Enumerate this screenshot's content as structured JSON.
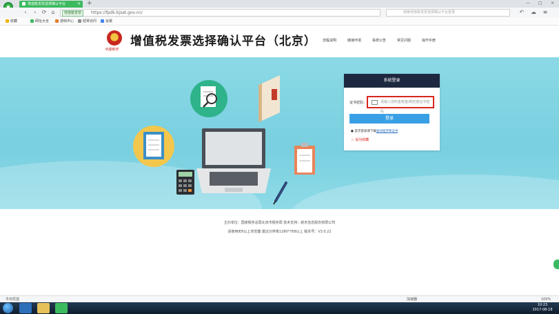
{
  "browser": {
    "tab_title": "增值税发票选择确认平台",
    "tab_close": "×",
    "new_tab": "+",
    "address_badge": "增值税发票",
    "address_url": "https://fpdk.bjsat.gov.cn/",
    "search_placeholder": "搜索增值税发票选择确认平台登录",
    "back": "‹",
    "forward": "›",
    "reload": "⟳",
    "home": "⌂"
  },
  "bookmarks": [
    {
      "label": "收藏",
      "color": "#f0b400"
    },
    {
      "label": "网址大全",
      "color": "#3cba5f"
    },
    {
      "label": "游戏中心",
      "color": "#e57d2a"
    },
    {
      "label": "经常访问",
      "color": "#8e8e8e"
    },
    {
      "label": "谷歌",
      "color": "#4285f4"
    }
  ],
  "site": {
    "title": "增值税发票选择确认平台（北京）",
    "emblem_text": "中国税务",
    "nav": [
      "流程说明",
      "链接环境",
      "系统公告",
      "常见问题",
      "操作手册"
    ]
  },
  "login": {
    "header": "系统登录",
    "field_label": "证书密码：",
    "field_placeholder": "请输入您的金税盘/税控盘证书密码",
    "button": "登录",
    "help_prefix": "● 首次登录请下载",
    "help_link": "驱动程序和证书",
    "favorite": "☆ 设为收藏"
  },
  "footer": {
    "line1": "主办单位：国家税务总局北京市税务局  技术支持：航天信息股份有限公司",
    "line2": "请使用IE8以上浏览器  建议分辨率1280*768以上  版本号：V3.0.22"
  },
  "statusbar": {
    "left": "今日优选",
    "mid": "加速器",
    "right": "100%"
  },
  "taskbar": {
    "time": "10:23",
    "date": "2017-08-18"
  },
  "colors": {
    "accent": "#3aa0e6",
    "hero": "#8bd9e6",
    "login_header": "#1d2740",
    "highlight": "#d9251c"
  }
}
